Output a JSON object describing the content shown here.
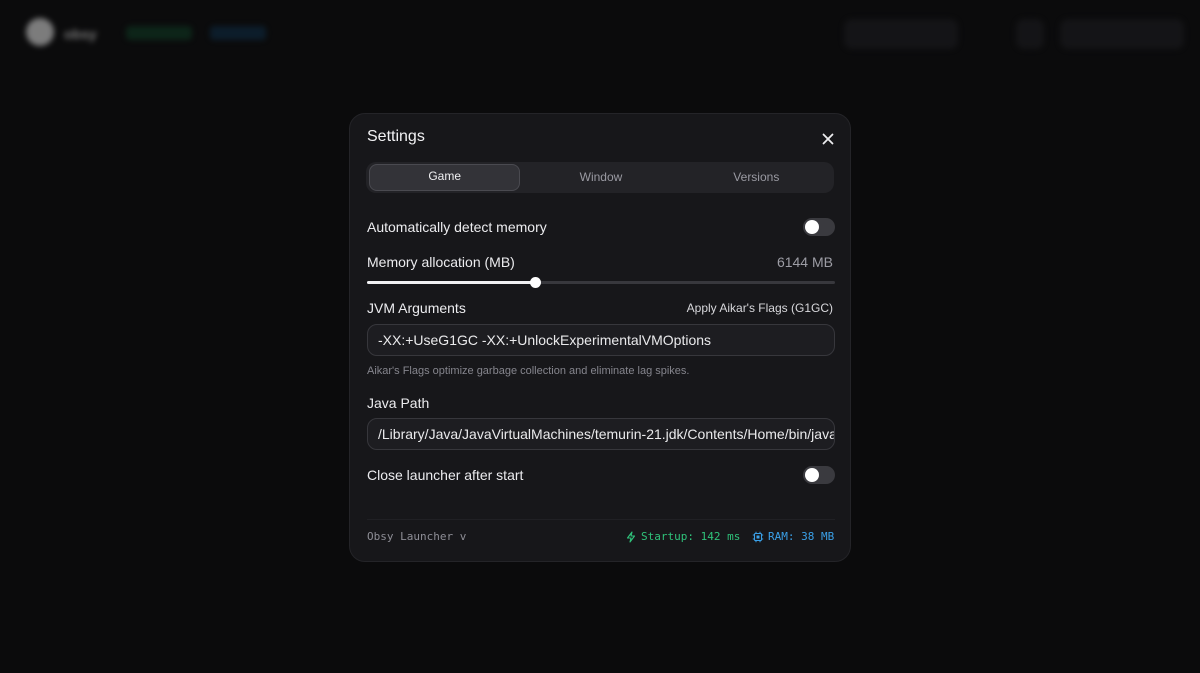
{
  "background": {
    "brand": "obsy",
    "pill_green": "",
    "pill_blue": ""
  },
  "modal": {
    "title": "Settings",
    "tabs": [
      {
        "label": "Game",
        "active": true
      },
      {
        "label": "Window",
        "active": false
      },
      {
        "label": "Versions",
        "active": false
      }
    ],
    "auto_memory": {
      "label": "Automatically detect memory",
      "enabled": false
    },
    "memory": {
      "label": "Memory allocation (MB)",
      "value_text": "6144 MB",
      "fraction": 0.36
    },
    "jvm": {
      "label": "JVM Arguments",
      "apply_flags": "Apply Aikar's Flags (G1GC)",
      "value": "-XX:+UseG1GC -XX:+UnlockExperimentalVMOptions",
      "hint": "Aikar's Flags optimize garbage collection and eliminate lag spikes."
    },
    "java_path": {
      "label": "Java Path",
      "value": "/Library/Java/JavaVirtualMachines/temurin-21.jdk/Contents/Home/bin/java"
    },
    "close_after_start": {
      "label": "Close launcher after start",
      "enabled": false
    },
    "footer": {
      "version": "Obsy Launcher v",
      "startup": "Startup: 142 ms",
      "ram": "RAM: 38 MB"
    }
  },
  "colors": {
    "accent_green": "#2fc27a",
    "accent_blue": "#3aa0e8"
  }
}
